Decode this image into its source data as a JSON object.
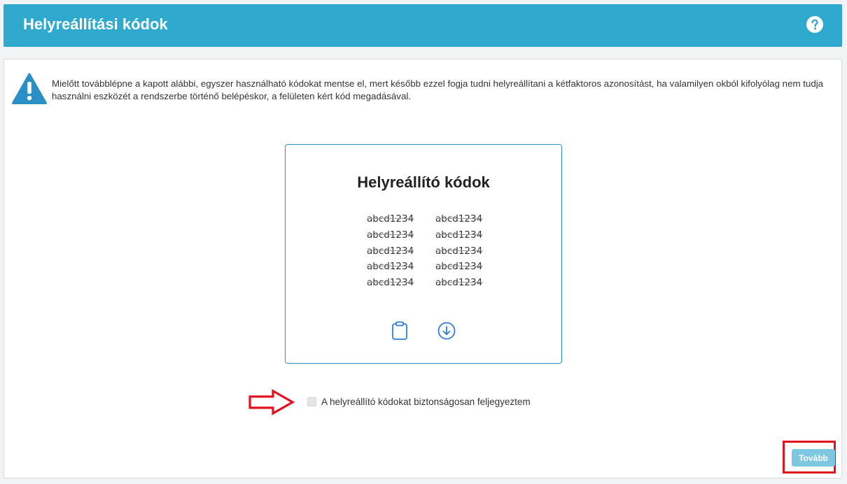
{
  "header": {
    "title": "Helyreállítási kódok",
    "help_icon": "question-circle-icon"
  },
  "warning": {
    "icon": "warning-triangle-icon",
    "text": "Mielőtt továbblépne a kapott alábbi, egyszer használható kódokat mentse el, mert később ezzel fogja tudni helyreállítani a kétfaktoros azonosítást, ha valamilyen okból kifolyólag nem tudja használni eszközét a rendszerbe történő belépéskor, a felületen kért kód megadásával."
  },
  "codes_card": {
    "title": "Helyreállító kódok",
    "codes": [
      "abcd1234",
      "abcd1234",
      "abcd1234",
      "abcd1234",
      "abcd1234",
      "abcd1234",
      "abcd1234",
      "abcd1234",
      "abcd1234",
      "abcd1234"
    ],
    "copy_icon": "clipboard-icon",
    "download_icon": "download-circle-icon"
  },
  "confirm": {
    "arrow_icon": "red-arrow-right-icon",
    "label": "A helyreállító kódokat biztonságosan feljegyeztem",
    "checked": false
  },
  "footer": {
    "next_label": "Tovább"
  },
  "colors": {
    "header_bg": "#2fa9ce",
    "card_border": "#2f8fc7",
    "icon_blue": "#2e7fd9",
    "warning_blue": "#2a8fc4",
    "highlight_red": "#e0131e",
    "next_button_bg": "#7ec7e0"
  }
}
